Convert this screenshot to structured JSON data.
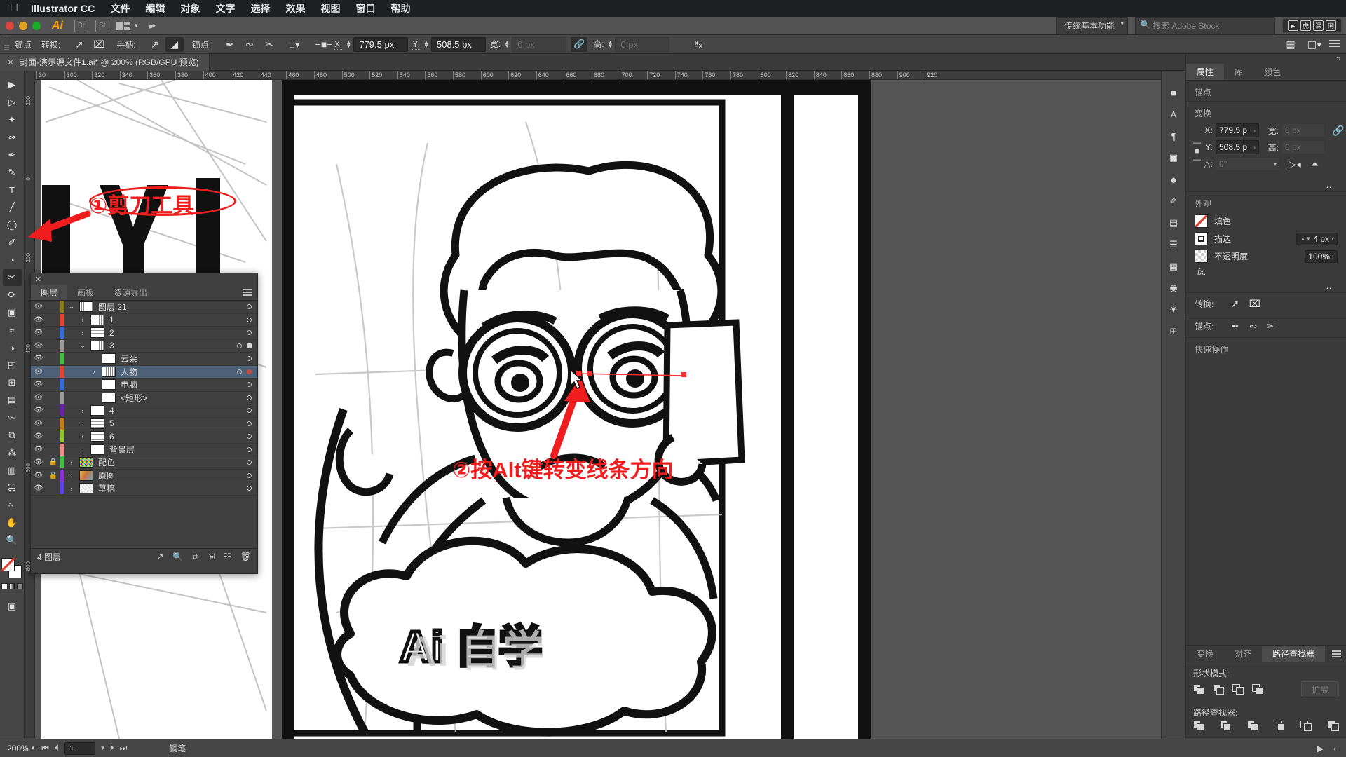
{
  "menubar": {
    "apple_icon": "apple-logo",
    "app_name": "Illustrator CC",
    "items": [
      "文件",
      "编辑",
      "对象",
      "文字",
      "选择",
      "效果",
      "视图",
      "窗口",
      "帮助"
    ]
  },
  "appbar": {
    "ai_logo": "Ai",
    "bridge_label": "Br",
    "stock_label": "St",
    "workspace": "传统基本功能",
    "search_placeholder": "搜索 Adobe Stock"
  },
  "controlbar": {
    "title": "锚点",
    "convert_label": "转换:",
    "handles_label": "手柄:",
    "anchors_label": "锚点:",
    "x_label": "X:",
    "x_value": "779.5 px",
    "y_label": "Y:",
    "y_value": "508.5 px",
    "w_label": "宽:",
    "w_value": "0 px",
    "h_label": "高:",
    "h_value": "0 px",
    "link_icon": "link-icon"
  },
  "document": {
    "tab_title": "封面-演示源文件1.ai* @ 200% (RGB/GPU 预览)",
    "close_icon": "close-icon"
  },
  "ruler": {
    "top_ticks": [
      "30",
      "300",
      "320",
      "340",
      "360",
      "380",
      "400",
      "420",
      "440",
      "460",
      "480",
      "500",
      "520",
      "540",
      "560",
      "580",
      "600",
      "620",
      "640",
      "660",
      "680",
      "700",
      "720",
      "740",
      "760",
      "780",
      "800",
      "820",
      "840",
      "860",
      "880",
      "900",
      "920"
    ],
    "left_ticks": [
      "200",
      "0",
      "200",
      "400",
      "600",
      "800"
    ]
  },
  "toolbox": {
    "tools": [
      {
        "name": "selection-tool",
        "glyph": "▶"
      },
      {
        "name": "direct-selection-tool",
        "glyph": "▷"
      },
      {
        "name": "magic-wand-tool",
        "glyph": "✦"
      },
      {
        "name": "lasso-tool",
        "glyph": "⊂"
      },
      {
        "name": "pen-tool",
        "glyph": "✒"
      },
      {
        "name": "curvature-tool",
        "glyph": "✎"
      },
      {
        "name": "type-tool",
        "glyph": "T"
      },
      {
        "name": "line-segment-tool",
        "glyph": "╱"
      },
      {
        "name": "ellipse-tool",
        "glyph": "◯"
      },
      {
        "name": "paintbrush-tool",
        "glyph": "✐"
      },
      {
        "name": "shaper-tool",
        "glyph": "◔"
      },
      {
        "name": "scissors-tool",
        "glyph": "✂"
      },
      {
        "name": "rotate-tool",
        "glyph": "↻"
      },
      {
        "name": "free-transform-tool",
        "glyph": "▣"
      },
      {
        "name": "width-tool",
        "glyph": "≈"
      },
      {
        "name": "shape-builder-tool",
        "glyph": "◑"
      },
      {
        "name": "perspective-grid-tool",
        "glyph": "◰"
      },
      {
        "name": "mesh-tool",
        "glyph": "⊞"
      },
      {
        "name": "gradient-tool",
        "glyph": "▤"
      },
      {
        "name": "eyedropper-tool",
        "glyph": "⚗"
      },
      {
        "name": "blend-tool",
        "glyph": "⧉"
      },
      {
        "name": "symbol-sprayer-tool",
        "glyph": "⁂"
      },
      {
        "name": "column-graph-tool",
        "glyph": "▥"
      },
      {
        "name": "artboard-tool",
        "glyph": "⌘"
      },
      {
        "name": "slice-tool",
        "glyph": "✁"
      },
      {
        "name": "hand-tool",
        "glyph": "✋"
      },
      {
        "name": "zoom-tool",
        "glyph": "ὐD"
      }
    ]
  },
  "layers_panel": {
    "close_icon": "close-icon",
    "tabs": [
      {
        "label": "图层",
        "active": true
      },
      {
        "label": "画板",
        "active": false
      },
      {
        "label": "资源导出",
        "active": false
      }
    ],
    "menu_icon": "panel-menu-icon",
    "rows": [
      {
        "name": "图层 21",
        "indent": 0,
        "color": "#8a7a12",
        "expanded": true,
        "has_arrow": true,
        "visible": true,
        "locked": false,
        "selected": false,
        "thumb": "art",
        "target": "circle"
      },
      {
        "name": "1",
        "indent": 1,
        "color": "#e5422b",
        "expanded": false,
        "has_arrow": true,
        "visible": true,
        "locked": false,
        "selected": false,
        "thumb": "art",
        "target": "circle"
      },
      {
        "name": "2",
        "indent": 1,
        "color": "#2e6ddb",
        "expanded": false,
        "has_arrow": true,
        "visible": true,
        "locked": false,
        "selected": false,
        "thumb": "lines",
        "target": "circle"
      },
      {
        "name": "3",
        "indent": 1,
        "color": "#9a9a9a",
        "expanded": true,
        "has_arrow": true,
        "visible": true,
        "locked": false,
        "selected": false,
        "thumb": "art",
        "target": "circle-dot"
      },
      {
        "name": "云朵",
        "indent": 2,
        "color": "#3fc13f",
        "expanded": false,
        "has_arrow": false,
        "visible": true,
        "locked": false,
        "selected": false,
        "thumb": "blank",
        "target": "circle"
      },
      {
        "name": "人物",
        "indent": 2,
        "color": "#e5422b",
        "expanded": false,
        "has_arrow": true,
        "visible": true,
        "locked": false,
        "selected": true,
        "thumb": "art",
        "target": "circle-red"
      },
      {
        "name": "电脑",
        "indent": 2,
        "color": "#2e6ddb",
        "expanded": false,
        "has_arrow": false,
        "visible": true,
        "locked": false,
        "selected": false,
        "thumb": "blank",
        "target": "circle"
      },
      {
        "name": "<矩形>",
        "indent": 2,
        "color": "#9a9a9a",
        "expanded": false,
        "has_arrow": false,
        "visible": true,
        "locked": false,
        "selected": false,
        "thumb": "blank",
        "target": "circle"
      },
      {
        "name": "4",
        "indent": 1,
        "color": "#6b1fa8",
        "expanded": false,
        "has_arrow": true,
        "visible": true,
        "locked": false,
        "selected": false,
        "thumb": "blank",
        "target": "circle"
      },
      {
        "name": "5",
        "indent": 1,
        "color": "#c87e10",
        "expanded": false,
        "has_arrow": true,
        "visible": true,
        "locked": false,
        "selected": false,
        "thumb": "lines",
        "target": "circle"
      },
      {
        "name": "6",
        "indent": 1,
        "color": "#8fc425",
        "expanded": false,
        "has_arrow": true,
        "visible": true,
        "locked": false,
        "selected": false,
        "thumb": "lines",
        "target": "circle"
      },
      {
        "name": "背景层",
        "indent": 1,
        "color": "#ef8a84",
        "expanded": false,
        "has_arrow": true,
        "visible": true,
        "locked": false,
        "selected": false,
        "thumb": "blank",
        "target": "circle"
      },
      {
        "name": "配色",
        "indent": 0,
        "color": "#3fc13f",
        "expanded": false,
        "has_arrow": true,
        "visible": true,
        "locked": true,
        "selected": false,
        "thumb": "swatches",
        "target": "circle"
      },
      {
        "name": "原图",
        "indent": 0,
        "color": "#8b2fd6",
        "expanded": false,
        "has_arrow": true,
        "visible": true,
        "locked": true,
        "selected": false,
        "thumb": "photo",
        "target": "circle"
      },
      {
        "name": "草稿",
        "indent": 0,
        "color": "#5b3fe0",
        "expanded": false,
        "has_arrow": true,
        "visible": true,
        "locked": false,
        "selected": false,
        "thumb": "sketch",
        "target": "circle"
      }
    ],
    "footer_count": "4 图层",
    "footer_icons": [
      "new-sublayer-icon",
      "locate-object-icon",
      "make-clipping-mask-icon",
      "new-layer-icon",
      "delete-layer-icon"
    ]
  },
  "properties_panel": {
    "tabs": [
      {
        "label": "属性",
        "active": true
      },
      {
        "label": "库",
        "active": false
      },
      {
        "label": "颜色",
        "active": false
      }
    ],
    "selection_label": "锚点",
    "transform": {
      "section_label": "变换",
      "x_label": "X:",
      "x_value": "779.5 p",
      "y_label": "Y:",
      "y_value": "508.5 p",
      "w_label": "宽:",
      "w_value": "0 px",
      "h_label": "高:",
      "h_value": "0 px",
      "angle_label": "△:",
      "angle_value": "0°",
      "flip_h_icon": "flip-horizontal-icon",
      "flip_v_icon": "flip-vertical-icon",
      "unlink_icon": "unlink-icon",
      "more_icon": "more-options-icon"
    },
    "appearance": {
      "section_label": "外观",
      "fill_label": "填色",
      "stroke_label": "描边",
      "stroke_value": "4 px",
      "opacity_label": "不透明度",
      "opacity_value": "100%",
      "fx_label": "fx.",
      "more_icon": "more-options-icon"
    },
    "convert": {
      "label": "转换:",
      "icons": [
        "convert-to-corner-icon",
        "convert-to-smooth-icon"
      ]
    },
    "anchors": {
      "label": "锚点:",
      "icons": [
        "pen-anchor-icon",
        "remove-anchor-icon",
        "cut-path-icon"
      ]
    },
    "quick_actions_label": "快速操作"
  },
  "pathfinder_panel": {
    "tabs": [
      {
        "label": "变换",
        "active": false
      },
      {
        "label": "对齐",
        "active": false
      },
      {
        "label": "路径查找器",
        "active": true
      }
    ],
    "menu_icon": "panel-menu-icon",
    "shape_modes_label": "形状模式:",
    "shape_modes": [
      "unite-icon",
      "minus-front-icon",
      "intersect-icon",
      "exclude-icon"
    ],
    "expand_button": "扩展",
    "pathfinders_label": "路径查找器:",
    "pathfinders": [
      "divide-icon",
      "trim-icon",
      "merge-icon",
      "crop-icon",
      "outline-icon",
      "minus-back-icon"
    ]
  },
  "right_strip": {
    "icons": [
      "color-panel-icon",
      "type-panel-icon",
      "paragraph-panel-icon",
      "gradient-panel-icon",
      "symbols-panel-icon",
      "brushes-panel-icon",
      "swatches-panel-icon",
      "stroke-panel-icon",
      "transparency-panel-icon",
      "appearance-panel-icon",
      "graphic-styles-panel-icon",
      "artboards-panel-icon"
    ]
  },
  "statusbar": {
    "zoom_value": "200%",
    "page_value": "1",
    "tool_name": "钢笔",
    "first_icon": "first-page-icon",
    "prev_icon": "prev-page-icon",
    "next_icon": "next-page-icon",
    "last_icon": "last-page-icon",
    "play_icon": "play-icon"
  },
  "annotations": {
    "step1": "①剪刀工具",
    "step2": "②按Alt键转变线条方向"
  },
  "artwork": {
    "title_text": "Ai自学",
    "description": "Pencil sketch of a cartoon boy with glasses holding a bow, drawn over by black vector outlines"
  },
  "colors": {
    "annotation_red": "#ef1d1d",
    "selection_blue": "#4c6178",
    "panel_bg": "#3a3a3a",
    "toolbar_bg": "#454545",
    "menubar_bg": "#1d1f22"
  }
}
